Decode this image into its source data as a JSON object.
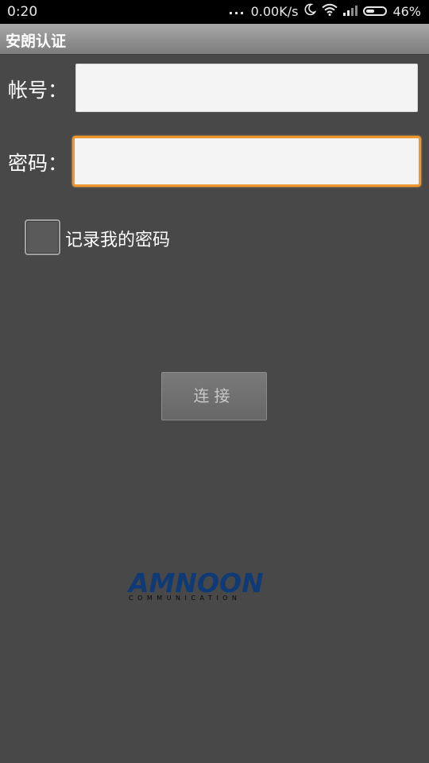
{
  "status_bar": {
    "time": "0:20",
    "dots": "...",
    "network_speed": "0.00K/s",
    "battery_percent": "46%",
    "battery_level": 0.46,
    "icons": [
      "moon-icon",
      "wifi-icon",
      "signal-icon",
      "battery-icon"
    ]
  },
  "app": {
    "title": "安朗认证"
  },
  "form": {
    "account_label": "帐号：",
    "account_value": "",
    "password_label": "密码：",
    "password_value": "",
    "remember_label": "记录我的密码",
    "remember_checked": false,
    "connect_label": "连接"
  },
  "logo": {
    "main_text": "AMNOON",
    "sub_text": "COMMUNICATION"
  },
  "colors": {
    "background": "#484848",
    "focus_border": "#f0962a",
    "logo_blue": "#0f3a75"
  }
}
